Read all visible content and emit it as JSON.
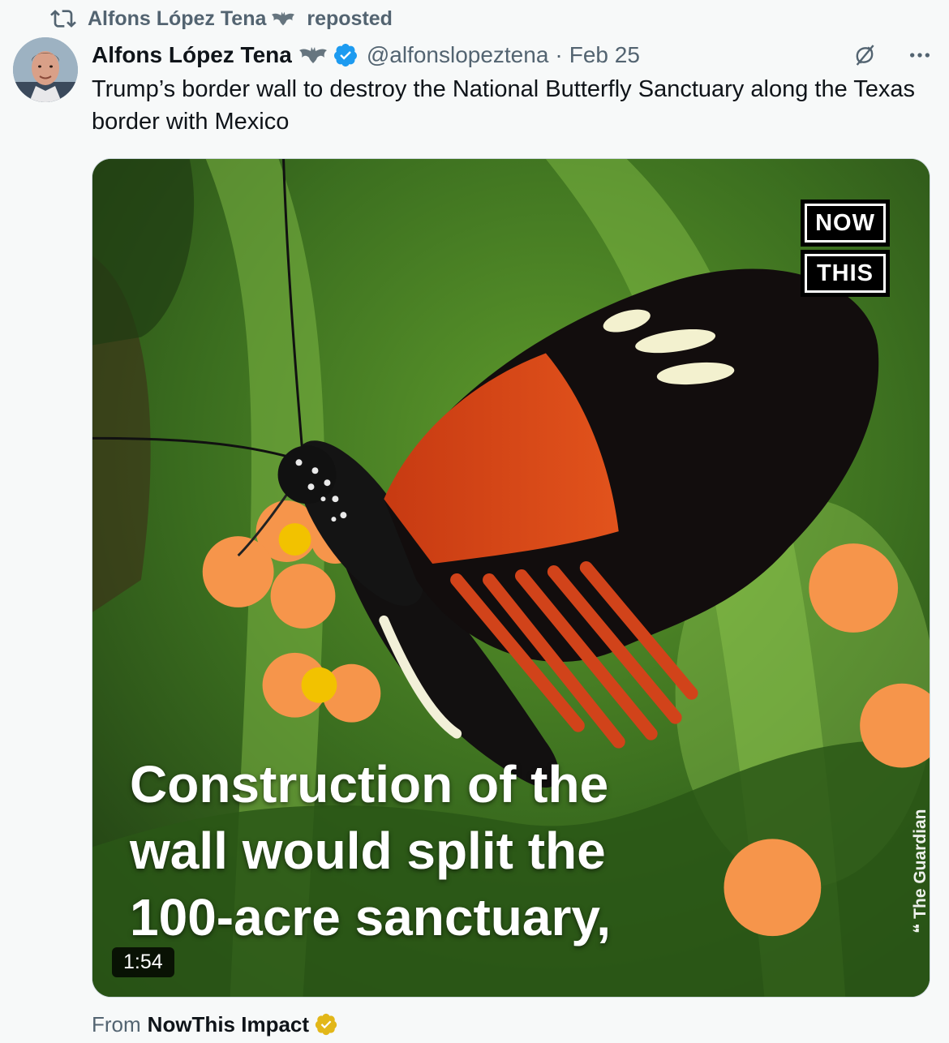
{
  "repost": {
    "icon": "repost-icon",
    "user": "Alfons López Tena",
    "label": "reposted"
  },
  "author": {
    "name": "Alfons López Tena",
    "handle": "@alfonslopeztena",
    "separator": "·",
    "date": "Feb 25",
    "verified": true,
    "verified_color": "#1d9bf0"
  },
  "tweet": {
    "text": "Trump’s border wall to destroy the National Butterfly Sanctuary along the Texas border with Mexico"
  },
  "media": {
    "logo": [
      "NOW",
      "THIS"
    ],
    "caption_lines": [
      "Construction of the",
      "wall would split the",
      "100-acre sanctuary,"
    ],
    "credit": "❝ The Guardian",
    "duration": "1:54"
  },
  "source": {
    "prefix": "From",
    "name": "NowThis Impact",
    "badge_color": "#e2b719"
  },
  "colors": {
    "secondary_text": "#536471",
    "primary_text": "#0f1419",
    "background": "#f7f9f9"
  }
}
